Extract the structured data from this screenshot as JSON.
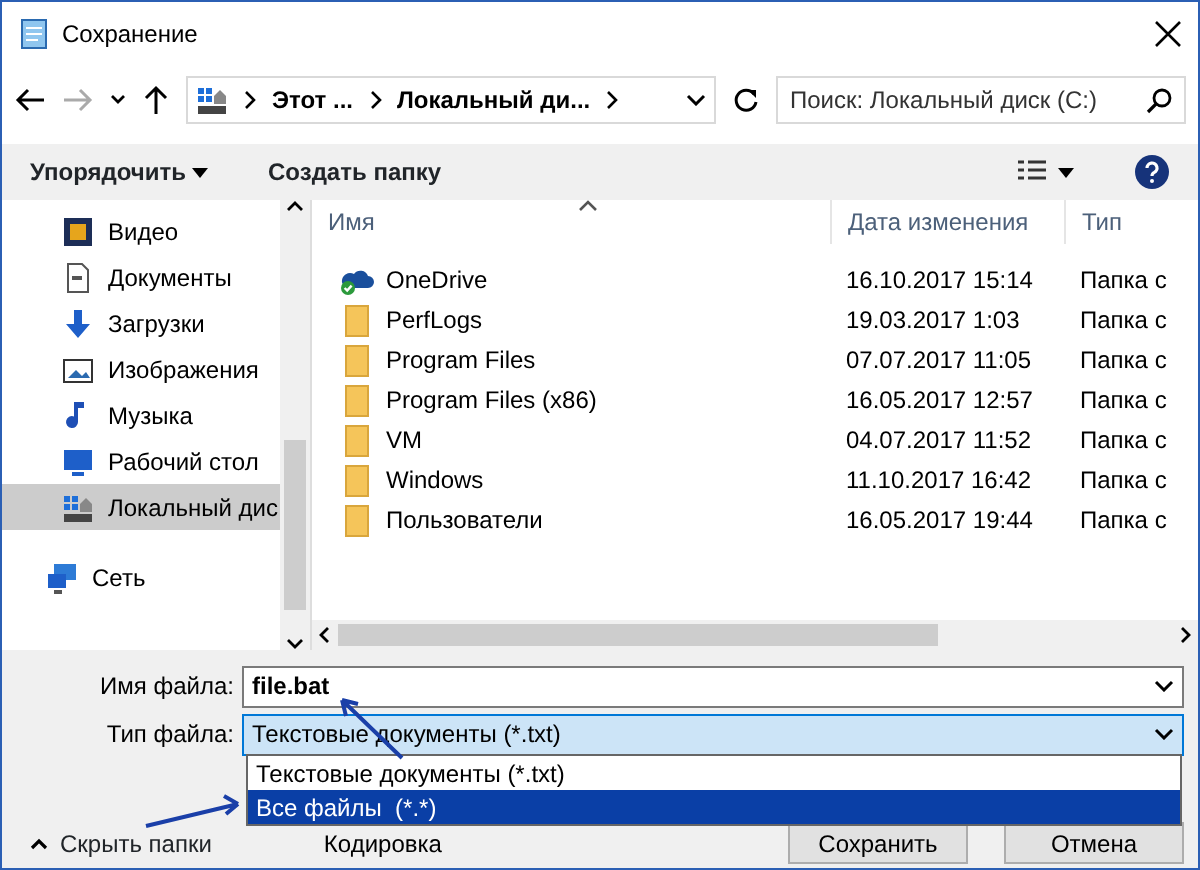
{
  "window": {
    "title": "Сохранение"
  },
  "nav": {
    "breadcrumbs": [
      "Этот ...",
      "Локальный ди..."
    ],
    "search_placeholder": "Поиск: Локальный диск (C:)"
  },
  "toolbar": {
    "organize": "Упорядочить",
    "new_folder": "Создать папку"
  },
  "sidebar": {
    "items": [
      {
        "label": "Видео",
        "kind": "video",
        "selected": false
      },
      {
        "label": "Документы",
        "kind": "documents",
        "selected": false
      },
      {
        "label": "Загрузки",
        "kind": "downloads",
        "selected": false
      },
      {
        "label": "Изображения",
        "kind": "pictures",
        "selected": false
      },
      {
        "label": "Музыка",
        "kind": "music",
        "selected": false
      },
      {
        "label": "Рабочий стол",
        "kind": "desktop",
        "selected": false
      },
      {
        "label": "Локальный дис",
        "kind": "drive",
        "selected": true
      },
      {
        "label": "Сеть",
        "kind": "network",
        "selected": false
      }
    ]
  },
  "table": {
    "columns": [
      "Имя",
      "Дата изменения",
      "Тип"
    ],
    "rows": [
      {
        "kind": "cloud",
        "name": "OneDrive",
        "date": "16.10.2017 15:14",
        "type": "Папка с"
      },
      {
        "kind": "folder",
        "name": "PerfLogs",
        "date": "19.03.2017 1:03",
        "type": "Папка с"
      },
      {
        "kind": "folder",
        "name": "Program Files",
        "date": "07.07.2017 11:05",
        "type": "Папка с"
      },
      {
        "kind": "folder",
        "name": "Program Files (x86)",
        "date": "16.05.2017 12:57",
        "type": "Папка с"
      },
      {
        "kind": "folder",
        "name": "VM",
        "date": "04.07.2017 11:52",
        "type": "Папка с"
      },
      {
        "kind": "folder",
        "name": "Windows",
        "date": "11.10.2017 16:42",
        "type": "Папка с"
      },
      {
        "kind": "folder",
        "name": "Пользователи",
        "date": "16.05.2017 19:44",
        "type": "Папка с"
      }
    ]
  },
  "form": {
    "file_name_label": "Имя файла:",
    "file_name": "file.bat",
    "file_type_label": "Тип файла:",
    "file_type": "Текстовые документы (*.txt)",
    "options": [
      {
        "label": "Текстовые документы (*.txt)",
        "selected": false
      },
      {
        "label": "Все файлы  (*.*)",
        "selected": true
      }
    ],
    "encoding_label": "Кодировка"
  },
  "hide_folders": "Скрыть папки",
  "buttons": [
    "Сохранить",
    "Отмена"
  ]
}
